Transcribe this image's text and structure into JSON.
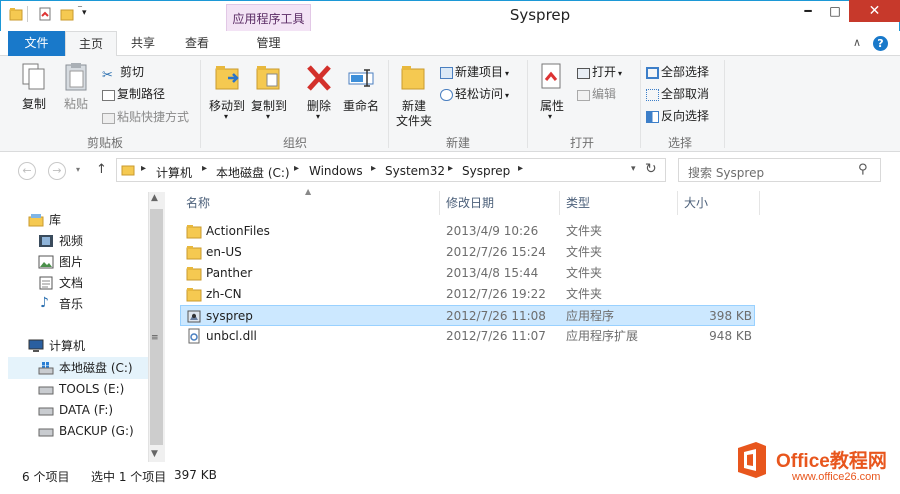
{
  "window": {
    "title": "Sysprep",
    "context_tab_group": "应用程序工具",
    "minimize_glyph": "━",
    "maximize_glyph": "□",
    "close_glyph": "✕"
  },
  "ribbon_tabs": {
    "file": "文件",
    "home": "主页",
    "share": "共享",
    "view": "查看",
    "manage": "管理"
  },
  "ribbon": {
    "clipboard": {
      "copy": "复制",
      "paste": "粘贴",
      "cut": "剪切",
      "copy_path": "复制路径",
      "paste_shortcut": "粘贴快捷方式",
      "label": "剪贴板"
    },
    "organize": {
      "move_to": "移动到",
      "copy_to": "复制到",
      "delete": "删除",
      "rename": "重命名",
      "label": "组织"
    },
    "new": {
      "new_folder_line1": "新建",
      "new_folder_line2": "文件夹",
      "new_item": "新建项目",
      "easy_access": "轻松访问",
      "label": "新建"
    },
    "open": {
      "properties": "属性",
      "open": "打开",
      "edit": "编辑",
      "label": "打开"
    },
    "select": {
      "select_all": "全部选择",
      "select_none": "全部取消",
      "invert": "反向选择",
      "label": "选择"
    }
  },
  "address": {
    "crumbs": [
      "计算机",
      "本地磁盘 (C:)",
      "Windows",
      "System32",
      "Sysprep"
    ],
    "search_placeholder": "搜索 Sysprep"
  },
  "nav": {
    "libraries": "库",
    "videos": "视频",
    "pictures": "图片",
    "documents": "文档",
    "music": "音乐",
    "computer": "计算机",
    "drive_c": "本地磁盘 (C:)",
    "drive_e": "TOOLS (E:)",
    "drive_f": "DATA (F:)",
    "drive_g": "BACKUP (G:)"
  },
  "columns": {
    "name": "名称",
    "date": "修改日期",
    "type": "类型",
    "size": "大小"
  },
  "files": [
    {
      "name": "ActionFiles",
      "date": "2013/4/9 10:26",
      "type": "文件夹",
      "size": ""
    },
    {
      "name": "en-US",
      "date": "2012/7/26 15:24",
      "type": "文件夹",
      "size": ""
    },
    {
      "name": "Panther",
      "date": "2013/4/8 15:44",
      "type": "文件夹",
      "size": ""
    },
    {
      "name": "zh-CN",
      "date": "2012/7/26 19:22",
      "type": "文件夹",
      "size": ""
    },
    {
      "name": "sysprep",
      "date": "2012/7/26 11:08",
      "type": "应用程序",
      "size": "398 KB"
    },
    {
      "name": "unbcl.dll",
      "date": "2012/7/26 11:07",
      "type": "应用程序扩展",
      "size": "948 KB"
    }
  ],
  "status": {
    "item_count": "6 个项目",
    "selected": "选中 1 个项目",
    "selected_size": "397 KB"
  },
  "watermark": {
    "line1": "Office教程网",
    "line2": "www.office26.com"
  },
  "colors": {
    "accent": "#1979ca",
    "selection": "#cce8ff",
    "close_red": "#c7392b",
    "context_tab": "#f3e3f5",
    "folder_yellow": "#f5c951"
  }
}
